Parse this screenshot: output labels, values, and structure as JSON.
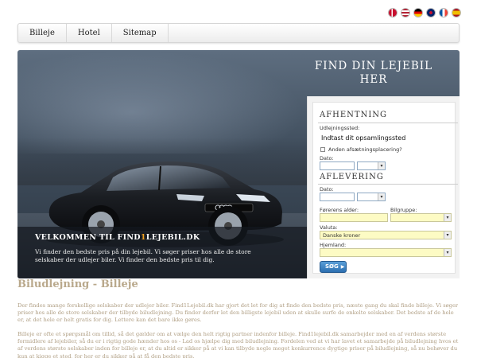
{
  "flags": [
    {
      "name": "danish-flag-icon",
      "color": "#c8102e"
    },
    {
      "name": "us-flag-icon",
      "color": "#3c3b6e"
    },
    {
      "name": "german-flag-icon",
      "color": "#ffce00"
    },
    {
      "name": "uk-flag-icon",
      "color": "#012169"
    },
    {
      "name": "french-flag-icon",
      "color": "#0055a4"
    },
    {
      "name": "spanish-flag-icon",
      "color": "#f1bf00"
    }
  ],
  "nav": {
    "items": [
      "Billeje",
      "Hotel",
      "Sitemap"
    ]
  },
  "hero": {
    "find_title": "FIND DIN LEJEBIL HER",
    "welcome_prefix": "VELKOMMEN TIL FIND",
    "welcome_accent": "1",
    "welcome_suffix": "LEJEBIL.DK",
    "welcome_text": "Vi finder den bedste pris på din lejebil. Vi søger priser hos alle de store selskaber der udlejer biler. Vi finder den bedste pris til dig.",
    "accent_color": "#f0a020"
  },
  "form": {
    "pickup_title": "AFHENTNING",
    "pickup_location_label": "Udlejningssted:",
    "pickup_location_value": "Indtast dit opsamlingssted",
    "other_dropoff_label": "Anden afsætningsplacering?",
    "pickup_date_label": "Dato:",
    "dropoff_title": "AFLEVERING",
    "dropoff_date_label": "Dato:",
    "driver_age_label": "Førerens alder:",
    "car_group_label": "Bilgruppe:",
    "currency_label": "Valuta:",
    "currency_value": "Danske kroner",
    "country_label": "Hjemland:",
    "search_button": "SØG"
  },
  "content": {
    "heading": "Biludlejning - Billeje",
    "paragraph1": "Der findes mange forskellige selskaber der udlejer biler. Find1Lejebil.dk har gjort det let for dig at finde den bedste pris, næste gang du skal finde billeje. Vi søger priser hos alle de store selskaber der tilbyde biludlejning. Du finder derfor let den billigste lejebil uden at skulle surfe de enkelte selskaber. Det bedste af de hele er, at det hele er helt gratis for dig. Lettere kan det bare ikke gøres.",
    "paragraph2": "Billeje er ofte et spørgsmål om tillid, så det gælder om at vælge den helt rigtig partner indenfor billeje. Find1lejebil.dk samarbejder med en af verdens største formidlere af lejebiler, så du er i rigtig gode hænder hos os - Lad os hjælpe dig med biludlejning. Fordelen ved at vi har lavet et samarbejde på biludlejning hvos et af verdens største selskaber inden for billeje er, at du altid er sikker på at vi kan tilbyde nogle meget konkurrence dygtige priser på biludlejning, så nu behøver du kun at kigge et sted, for her er du sikker på at få den bedste pris."
  }
}
